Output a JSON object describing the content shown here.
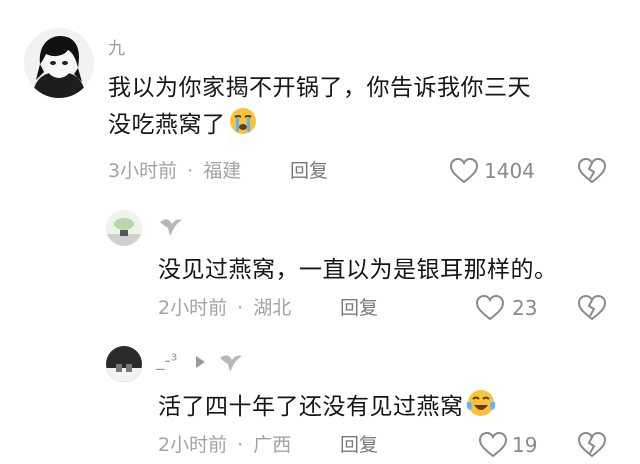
{
  "comments": [
    {
      "username": "九",
      "line1": "我以为你家揭不开锅了，你告诉我你三天",
      "line2": "没吃燕窝了",
      "emoji": "crying-face-emoji",
      "time": "3小时前",
      "separator": "·",
      "location": "福建",
      "reply_label": "回复",
      "like_count": "1404"
    },
    {
      "username": "",
      "text": "没见过燕窝，一直以为是银耳那样的。",
      "time": "2小时前",
      "separator": "·",
      "location": "湖北",
      "reply_label": "回复",
      "like_count": "23"
    },
    {
      "username": "_-³",
      "text": "活了四十年了还没有见过燕窝",
      "emoji": "tears-of-joy-emoji",
      "time": "2小时前",
      "separator": "·",
      "location": "广西",
      "reply_label": "回复",
      "like_count": "19"
    }
  ],
  "colors": {
    "text": "#161616",
    "meta": "#a3a3a3",
    "icon": "#8a8a8a"
  }
}
